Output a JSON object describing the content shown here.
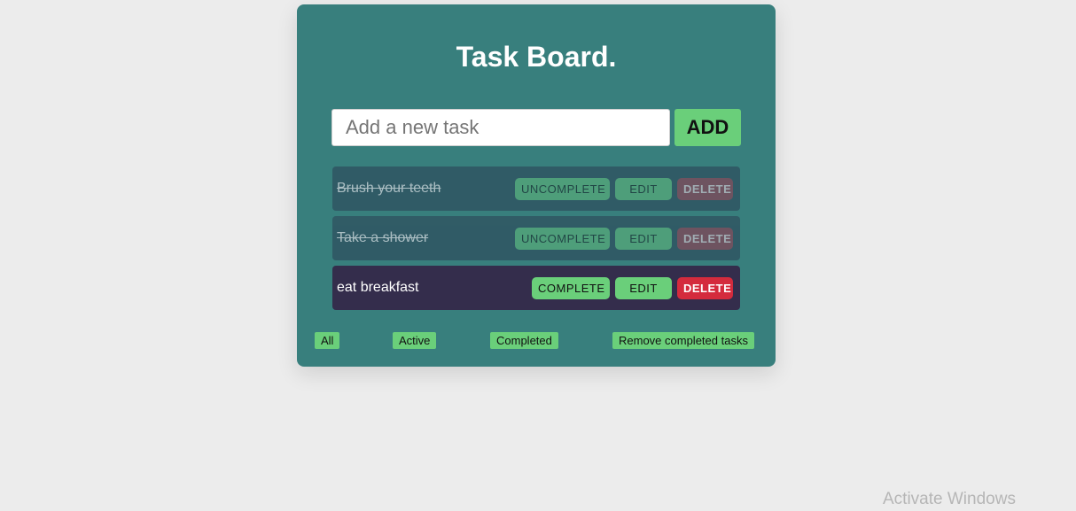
{
  "app": {
    "title": "Task Board."
  },
  "new_task": {
    "placeholder": "Add a new task",
    "value": "",
    "add_label": "ADD"
  },
  "tasks": [
    {
      "text": "Brush your teeth",
      "completed": true,
      "toggle_label": "UNCOMPLETE",
      "edit_label": "EDIT",
      "delete_label": "DELETE"
    },
    {
      "text": "Take a shower",
      "completed": true,
      "toggle_label": "UNCOMPLETE",
      "edit_label": "EDIT",
      "delete_label": "DELETE"
    },
    {
      "text": "eat breakfast",
      "completed": false,
      "toggle_label": "COMPLETE",
      "edit_label": "EDIT",
      "delete_label": "DELETE"
    }
  ],
  "filters": {
    "all": "All",
    "active": "Active",
    "completed": "Completed",
    "remove_completed": "Remove completed tasks"
  },
  "watermark": "Activate Windows",
  "colors": {
    "page_background": "#ececec",
    "card_background": "#387f7d",
    "accent_green": "#6acf7a",
    "delete_red": "#d42b3d",
    "active_task_background": "#342d4c",
    "completed_task_background": "#2f5462"
  }
}
